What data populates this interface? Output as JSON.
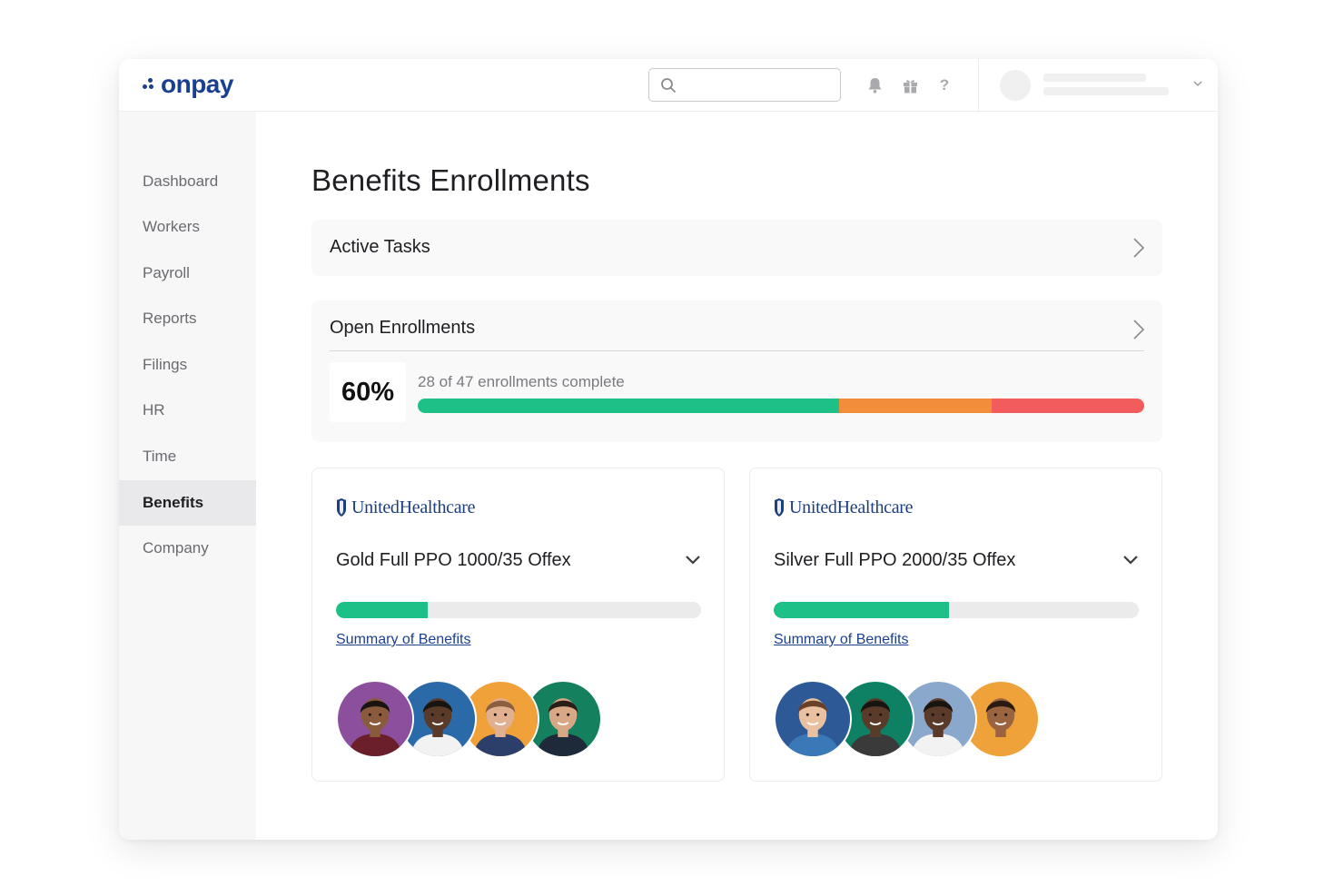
{
  "brand": {
    "name": "onpay",
    "color": "#1b3f8f"
  },
  "search": {
    "placeholder": ""
  },
  "topbar_icons": [
    "search-icon",
    "bell-icon",
    "gift-icon",
    "help-icon",
    "chevron-down-icon"
  ],
  "sidebar": {
    "items": [
      {
        "label": "Dashboard",
        "active": false
      },
      {
        "label": "Workers",
        "active": false
      },
      {
        "label": "Payroll",
        "active": false
      },
      {
        "label": "Reports",
        "active": false
      },
      {
        "label": "Filings",
        "active": false
      },
      {
        "label": "HR",
        "active": false
      },
      {
        "label": "Time",
        "active": false
      },
      {
        "label": "Benefits",
        "active": true
      },
      {
        "label": "Company",
        "active": false
      }
    ]
  },
  "page": {
    "title": "Benefits Enrollments"
  },
  "active_tasks": {
    "title": "Active Tasks"
  },
  "open_enrollments": {
    "title": "Open Enrollments",
    "percent": "60%",
    "progress_text": "28 of 47 enrollments complete",
    "segments": [
      {
        "fraction": 0.58,
        "color": "#1dc187"
      },
      {
        "fraction": 0.21,
        "color": "#f28e3a"
      },
      {
        "fraction": 0.21,
        "color": "#f25c5c"
      }
    ]
  },
  "plans": [
    {
      "carrier": "UnitedHealthcare",
      "name": "Gold Full PPO 1000/35 Offex",
      "progress": 0.25,
      "link": "Summary of Benefits",
      "avatars": [
        {
          "bg": "#8b4f9e",
          "skin": "#8a5a3c",
          "hair": "#1a1410",
          "shirt": "#6b1f2a"
        },
        {
          "bg": "#2a6aa8",
          "skin": "#5a3a28",
          "hair": "#1a1410",
          "shirt": "#f2f2f2"
        },
        {
          "bg": "#f0a13a",
          "skin": "#e0b090",
          "hair": "#8a6040",
          "shirt": "#2c3e6a"
        },
        {
          "bg": "#15805e",
          "skin": "#d8a886",
          "hair": "#2a1e16",
          "shirt": "#1e2a3a"
        }
      ]
    },
    {
      "carrier": "UnitedHealthcare",
      "name": "Silver Full PPO 2000/35 Offex",
      "progress": 0.48,
      "link": "Summary of Benefits",
      "avatars": [
        {
          "bg": "#2d5a96",
          "skin": "#eac1a0",
          "hair": "#6a4028",
          "shirt": "#3a78b8"
        },
        {
          "bg": "#0e8064",
          "skin": "#5a3a28",
          "hair": "#1a1410",
          "shirt": "#3a3a3a"
        },
        {
          "bg": "#8aa8cc",
          "skin": "#5a3a28",
          "hair": "#1a1410",
          "shirt": "#f2f2f2"
        },
        {
          "bg": "#f0a23a",
          "skin": "#9a6440",
          "hair": "#2a1a10",
          "shirt": "#f0a23a"
        }
      ]
    }
  ]
}
